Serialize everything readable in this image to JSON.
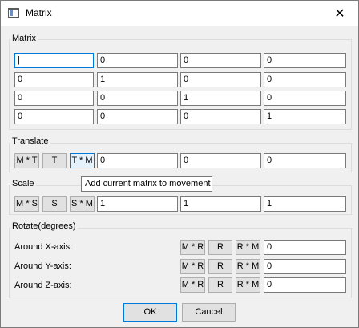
{
  "window": {
    "title": "Matrix",
    "close_glyph": "✕"
  },
  "matrix": {
    "label": "Matrix",
    "rows": [
      [
        "|",
        "0",
        "0",
        "0"
      ],
      [
        "0",
        "1",
        "0",
        "0"
      ],
      [
        "0",
        "0",
        "1",
        "0"
      ],
      [
        "0",
        "0",
        "0",
        "1"
      ]
    ]
  },
  "translate": {
    "label": "Translate",
    "buttons": [
      "M * T",
      "T",
      "T * M"
    ],
    "values": [
      "0",
      "0",
      "0"
    ]
  },
  "tooltip": "Add current matrix to movement",
  "scale": {
    "label": "Scale",
    "buttons": [
      "M * S",
      "S",
      "S * M"
    ],
    "values": [
      "1",
      "1",
      "1"
    ]
  },
  "rotate": {
    "label": "Rotate(degrees)",
    "rows": [
      {
        "label": "Around X-axis:",
        "buttons": [
          "M * R",
          "R",
          "R * M"
        ],
        "value": "0"
      },
      {
        "label": "Around Y-axis:",
        "buttons": [
          "M * R",
          "R",
          "R * M"
        ],
        "value": "0"
      },
      {
        "label": "Around Z-axis:",
        "buttons": [
          "M * R",
          "R",
          "R * M"
        ],
        "value": "0"
      }
    ]
  },
  "footer": {
    "ok": "OK",
    "cancel": "Cancel"
  }
}
